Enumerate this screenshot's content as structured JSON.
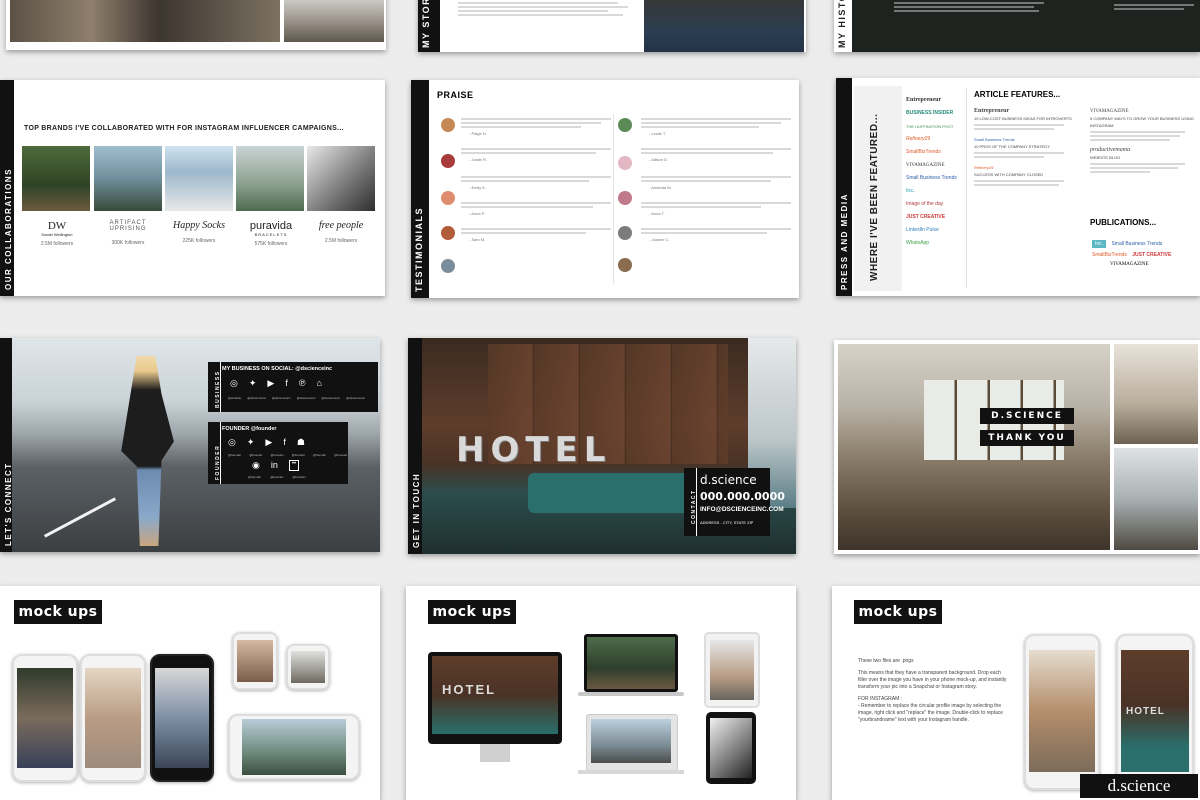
{
  "row1": {
    "story_label": "MY STORY",
    "history_label": "MY HISTORY"
  },
  "collaborations": {
    "side_label": "OUR COLLABORATIONS",
    "title": "TOP BRANDS I'VE COLLABORATED WITH FOR INSTAGRAM INFLUENCER CAMPAIGNS...",
    "brands": [
      {
        "name": "DW",
        "sub": "Daniel Wellington",
        "followers": "2.5M followers"
      },
      {
        "name": "ARTIFACT UPRISING",
        "sub": "",
        "followers": "300K followers"
      },
      {
        "name": "Happy Socks",
        "sub": "",
        "followers": "225K followers"
      },
      {
        "name": "puravida",
        "sub": "BRACELETS",
        "followers": "575K followers"
      },
      {
        "name": "free people",
        "sub": "",
        "followers": "2.5M followers"
      }
    ]
  },
  "testimonials": {
    "side_label": "TESTIMONIALS",
    "title": "PRAISE",
    "left_names": [
      "- Paige H.",
      "- Justin R.",
      "- Emily K.",
      "- Anna P.",
      "- Sam M."
    ],
    "right_names": [
      "- Leslie T.",
      "- Allison D.",
      "- Amanda M.",
      "- Anna T.",
      "- Joanne C."
    ]
  },
  "press": {
    "side_label": "PRESS AND MEDIA",
    "heading_vertical": "WHERE I'VE BEEN FEATURED...",
    "article_title": "ARTICLE FEATURES...",
    "publications_title": "PUBLICATIONS...",
    "logos_left": [
      "Entrepreneur",
      "BUSINESS INSIDER",
      "THE HUFFINGTON POST",
      "Refinery29",
      "SmallBizTrends",
      "VIVAMAGAZINE",
      "Small Business Trends",
      "Inc.",
      "Image of the day",
      "JUST CREATIVE",
      "LinkedIn Pulse",
      "WhatsApp"
    ],
    "articles_col1": [
      "Entrepreneur",
      "10 LOW-COST BUSINESS IDEAS FOR INTROVERTS",
      "Small Business Trends",
      "10 PROS OF THE COMPANY STRATEGY",
      "Refinery29",
      "SUCCESS WITH COMPANY CLOSED"
    ],
    "articles_col2": [
      "VIVAMAGAZINE",
      "5 COMPANY WAYS TO GROW YOUR BUSINESS USING INSTAGRAM",
      "productivemama",
      "WEBSITE BLOG"
    ],
    "publications": [
      "Inc.",
      "Small Business Trends",
      "SmallBizTrends",
      "JUST CREATIVE",
      "VIVAMAGAZINE"
    ]
  },
  "connect": {
    "side_label": "LET'S CONNECT",
    "business_tab": "BUSINESS",
    "business_heading": "MY BUSINESS ON SOCIAL: @dscienceinc",
    "business_handles": [
      "@website",
      "@dscienceinc",
      "@dscienceinc",
      "@dscienceinc",
      "@dscienceinc",
      "@dscienceinc"
    ],
    "founder_tab": "FOUNDER",
    "founder_heading": "FOUNDER @founder",
    "founder_handles": [
      "@founder",
      "@founder",
      "@founder",
      "@founder",
      "@founder",
      "@founder",
      "@founder",
      "@founder",
      "@founder"
    ],
    "icons_business": [
      "instagram-icon",
      "twitter-icon",
      "youtube-icon",
      "facebook-icon",
      "pinterest-icon"
    ],
    "icons_founder_row1": [
      "instagram-icon",
      "twitter-icon",
      "youtube-icon",
      "facebook-icon",
      "snapchat-icon"
    ],
    "icons_founder_row2": [
      "periscope-icon",
      "linkedin-icon",
      "flickr-icon"
    ]
  },
  "contact": {
    "side_label": "GET IN TOUCH",
    "tab": "CONTACT",
    "sign_text": "HOTEL",
    "company": "d.science",
    "phone": "000.000.0000",
    "email": "INFO@DSCIENCEINC.COM",
    "address": "ADDRESS - CITY, STATE ZIP"
  },
  "thanks": {
    "line1": "D.SCIENCE",
    "line2": "THANK YOU"
  },
  "mockups": {
    "label": "mock ups",
    "hotel_text": "HOTEL",
    "note_p1": "These two files are .pngs",
    "note_p2": "This means that they have a transparent background. Drop each filler over the image you have in your phone mock-up, and instantly transform your pic into a Snapchat or Instagram story.",
    "note_h": "FOR INSTAGRAM :",
    "note_p3": "- Remember to replace the circular profile image by selecting the image, right click and \"replace\" the image. Double-click to replace \"yourbrandname\" text with your Instagram handle."
  },
  "watermark": "d.science",
  "colors": {
    "black": "#111111",
    "accent_teal": "#2a6f6b"
  }
}
